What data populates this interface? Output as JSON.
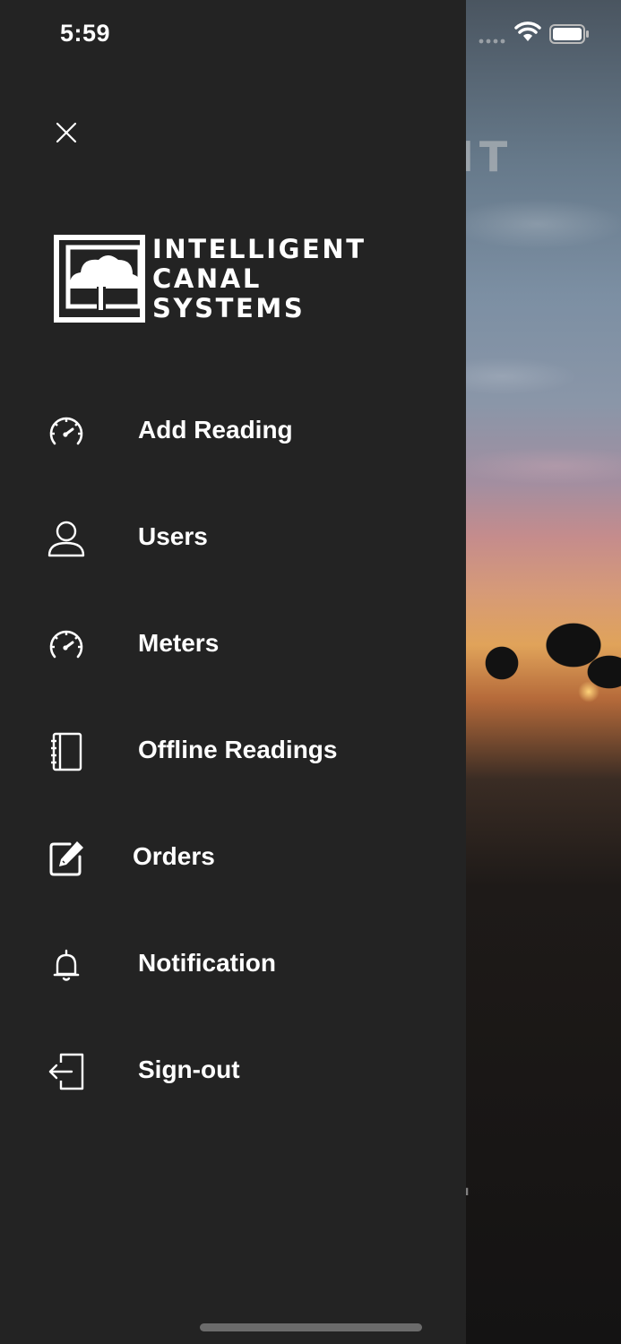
{
  "status_bar": {
    "time": "5:59",
    "icons": [
      "cellular-signal-icon",
      "wifi-icon",
      "battery-icon"
    ]
  },
  "background": {
    "title_fragment": "ENT",
    "subtitle_fragment": "AL"
  },
  "drawer": {
    "close_icon": "close-icon",
    "logo": {
      "lines": [
        "INTELLIGENT",
        "CANAL",
        "SYSTEMS"
      ]
    },
    "menu": [
      {
        "label": "Add Reading",
        "icon": "gauge-icon"
      },
      {
        "label": "Users",
        "icon": "user-icon"
      },
      {
        "label": "Meters",
        "icon": "gauge-icon"
      },
      {
        "label": "Offline Readings",
        "icon": "notebook-icon"
      },
      {
        "label": "Orders",
        "icon": "edit-icon"
      },
      {
        "label": "Notification",
        "icon": "bell-icon"
      },
      {
        "label": "Sign-out",
        "icon": "sign-out-icon"
      }
    ]
  },
  "colors": {
    "drawer_bg": "#232323",
    "text": "#ffffff"
  }
}
